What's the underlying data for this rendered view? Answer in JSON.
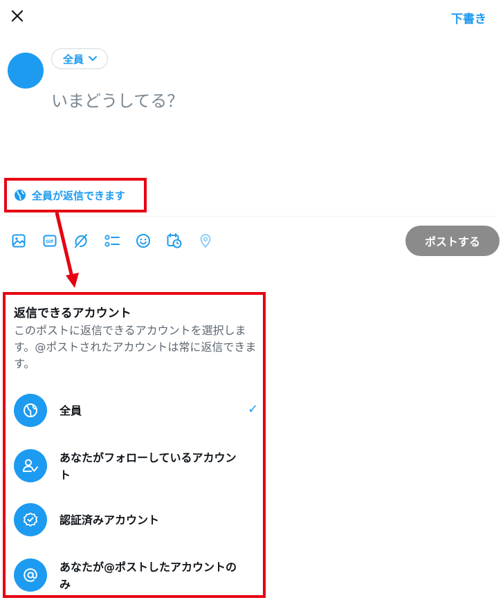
{
  "header": {
    "draft_label": "下書き"
  },
  "composer": {
    "audience_label": "全員",
    "placeholder": "いまどうしてる？",
    "reply_setting_label": "全員が返信できます"
  },
  "toolbar": {
    "icons": [
      "image-icon",
      "gif-icon",
      "grok-icon",
      "poll-icon",
      "emoji-icon",
      "schedule-icon",
      "location-icon"
    ],
    "post_label": "ポストする"
  },
  "reply_popup": {
    "title": "返信できるアカウント",
    "description": "このポストに返信できるアカウントを選択します。@ポストされたアカウントは常に返信できます。",
    "options": [
      {
        "label": "全員",
        "icon": "globe-icon",
        "selected": true
      },
      {
        "label": "あなたがフォローしているアカウント",
        "icon": "person-check-icon",
        "selected": false
      },
      {
        "label": "認証済みアカウント",
        "icon": "verified-icon",
        "selected": false
      },
      {
        "label": "あなたが@ポストしたアカウントのみ",
        "icon": "at-sign-icon",
        "selected": false
      }
    ],
    "check_mark": "✓"
  },
  "colors": {
    "accent": "#1d9bf0",
    "highlight": "#e60012",
    "post_button_disabled": "#8b8b8b"
  }
}
